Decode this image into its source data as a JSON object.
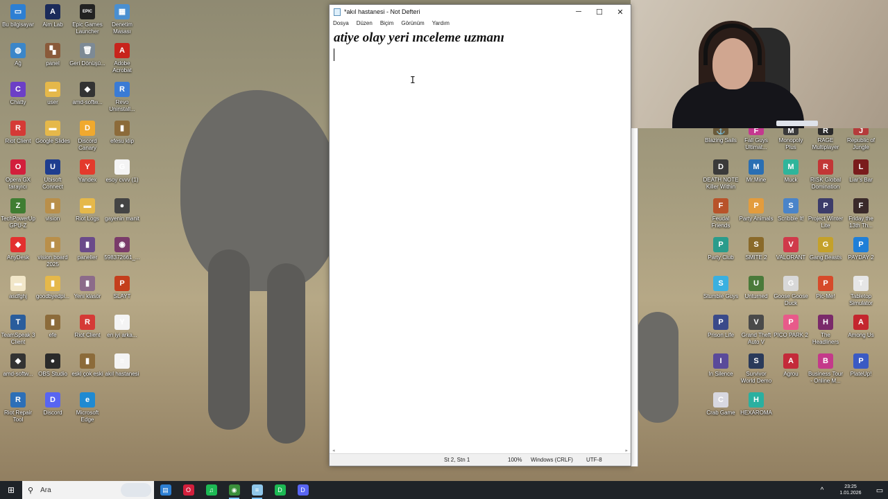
{
  "desktop": {
    "icons_left": [
      {
        "label": "Bu bilgisayar",
        "glyph": "▭",
        "color": "#2d7fd3"
      },
      {
        "label": "Aim Lab",
        "glyph": "A",
        "color": "#1b2b5a"
      },
      {
        "label": "Epic Games Launcher",
        "glyph": "EPIC",
        "color": "#222222"
      },
      {
        "label": "Denetim Masası",
        "glyph": "▦",
        "color": "#4a8fd0"
      },
      {
        "label": "Ağ",
        "glyph": "◍",
        "color": "#3b86c9"
      },
      {
        "label": "panel",
        "glyph": "▚",
        "color": "#8a5a3a"
      },
      {
        "label": "Geri Dönüşü...",
        "glyph": "🗑",
        "color": "#7d8a95"
      },
      {
        "label": "Adobe Acrobat",
        "glyph": "A",
        "color": "#c8241c"
      },
      {
        "label": "Chatty",
        "glyph": "C",
        "color": "#6c3fc7"
      },
      {
        "label": "user",
        "glyph": "▬",
        "color": "#e5b84a"
      },
      {
        "label": "amd-softw...",
        "glyph": "◆",
        "color": "#333333"
      },
      {
        "label": "Revo Uninstall...",
        "glyph": "R",
        "color": "#3a7bd5"
      },
      {
        "label": "Riot Client",
        "glyph": "R",
        "color": "#d53a36"
      },
      {
        "label": "Google Slides",
        "glyph": "▬",
        "color": "#e5b84a"
      },
      {
        "label": "Discord Canary",
        "glyph": "D",
        "color": "#f0a92e"
      },
      {
        "label": "efesu klip",
        "glyph": "▮",
        "color": "#8c6b3a"
      },
      {
        "label": "Opera GX tarayıcı",
        "glyph": "O",
        "color": "#d21f3c"
      },
      {
        "label": "Ubisoft Connect",
        "glyph": "U",
        "color": "#1e3d8f"
      },
      {
        "label": "Yandex",
        "glyph": "Y",
        "color": "#e33a2c"
      },
      {
        "label": "esoy cvvv (1)",
        "glyph": "G",
        "color": "#f4f4f4"
      },
      {
        "label": "TechPowerUp GPU-Z",
        "glyph": "Z",
        "color": "#3f7d32"
      },
      {
        "label": "vision",
        "glyph": "▮",
        "color": "#b98f4a"
      },
      {
        "label": "Riot Logs",
        "glyph": "▬",
        "color": "#e5b84a"
      },
      {
        "label": "gayenin manit",
        "glyph": "●",
        "color": "#444444"
      },
      {
        "label": "AnyDesk",
        "glyph": "◆",
        "color": "#e3302f"
      },
      {
        "label": "vision board 2025",
        "glyph": "▮",
        "color": "#b98f4a"
      },
      {
        "label": "paneller",
        "glyph": "▮",
        "color": "#6a4a8a"
      },
      {
        "label": "598372661_...",
        "glyph": "◉",
        "color": "#7a3b6a"
      },
      {
        "label": "asdfghj",
        "glyph": "▬",
        "color": "#f2e7c9"
      },
      {
        "label": "goodbyedpi...",
        "glyph": "▮",
        "color": "#e5b84a"
      },
      {
        "label": "Yeni klasör",
        "glyph": "▮",
        "color": "#8c6b8a"
      },
      {
        "label": "SLAYT",
        "glyph": "P",
        "color": "#c43e1c"
      },
      {
        "label": "TeamSpeak 3 Client",
        "glyph": "T",
        "color": "#2a5d9c"
      },
      {
        "label": "efe",
        "glyph": "▮",
        "color": "#8c6b3a"
      },
      {
        "label": "Riot Client",
        "glyph": "R",
        "color": "#d53a36"
      },
      {
        "label": "en iyi arka...",
        "glyph": "Y",
        "color": "#f4f4f4"
      },
      {
        "label": "amd-softw...",
        "glyph": "◆",
        "color": "#333333"
      },
      {
        "label": "OBS Studio",
        "glyph": "●",
        "color": "#2a2a2a"
      },
      {
        "label": "eski çok eski",
        "glyph": "▮",
        "color": "#8c6b3a"
      },
      {
        "label": "akıl hastanesi",
        "glyph": "≡",
        "color": "#f4f4f4"
      },
      {
        "label": "Riot Repair Tool",
        "glyph": "R",
        "color": "#2d6fb7"
      },
      {
        "label": "Discord",
        "glyph": "D",
        "color": "#5865f2"
      },
      {
        "label": "Microsoft Edge",
        "glyph": "e",
        "color": "#1f8ad2"
      }
    ],
    "icons_right": [
      {
        "label": "Blazing Sails",
        "glyph": "⚓",
        "color": "#6a5a3a"
      },
      {
        "label": "Fall Guys Ultimat...",
        "glyph": "F",
        "color": "#c4388f"
      },
      {
        "label": "Monopoly Plus",
        "glyph": "M",
        "color": "#3a3a3a"
      },
      {
        "label": "RAGE Multiplayer",
        "glyph": "R",
        "color": "#2b2b2b"
      },
      {
        "label": "Republic of Jungle",
        "glyph": "J",
        "color": "#b53b3b"
      },
      {
        "label": "DEATH NOTE Killer Within",
        "glyph": "D",
        "color": "#3a3a3a"
      },
      {
        "label": "Mr.Mine",
        "glyph": "M",
        "color": "#2a6fb3"
      },
      {
        "label": "Muck",
        "glyph": "M",
        "color": "#2fb59b"
      },
      {
        "label": "RISK Global Domination",
        "glyph": "R",
        "color": "#c23636"
      },
      {
        "label": "Liar's Bar",
        "glyph": "L",
        "color": "#7a1c1c"
      },
      {
        "label": "Feudal Friends",
        "glyph": "F",
        "color": "#b8532a"
      },
      {
        "label": "Party Animals",
        "glyph": "P",
        "color": "#e39c3d"
      },
      {
        "label": "Scribble It!",
        "glyph": "S",
        "color": "#4a84c9"
      },
      {
        "label": "Project Winter Lite",
        "glyph": "P",
        "color": "#3c3c6a"
      },
      {
        "label": "Friday the 13th Th...",
        "glyph": "F",
        "color": "#3a2a2a"
      },
      {
        "label": "Party Club",
        "glyph": "P",
        "color": "#2a9c8c"
      },
      {
        "label": "SMITE 2",
        "glyph": "S",
        "color": "#8a6a2a"
      },
      {
        "label": "VALORANT",
        "glyph": "V",
        "color": "#d03a4a"
      },
      {
        "label": "Gang Beasts",
        "glyph": "G",
        "color": "#c4a12a"
      },
      {
        "label": "PAYDAY 2",
        "glyph": "P",
        "color": "#1f7fd8"
      },
      {
        "label": "Stumble Guys",
        "glyph": "S",
        "color": "#3ab0e0"
      },
      {
        "label": "Unturned",
        "glyph": "U",
        "color": "#4a7a3a"
      },
      {
        "label": "Goose Goose Duck",
        "glyph": "G",
        "color": "#d8d8d8"
      },
      {
        "label": "Pic-Me!",
        "glyph": "P",
        "color": "#d64a2a"
      },
      {
        "label": "Tabletop Simulator",
        "glyph": "T",
        "color": "#e6e6e6"
      },
      {
        "label": "Prison Life",
        "glyph": "P",
        "color": "#3a4a8a"
      },
      {
        "label": "Grand Theft Auto V",
        "glyph": "V",
        "color": "#4a4a4a"
      },
      {
        "label": "PICO PARK 2",
        "glyph": "P",
        "color": "#e85a8a"
      },
      {
        "label": "The Headliners",
        "glyph": "H",
        "color": "#7a2a6a"
      },
      {
        "label": "Among Us",
        "glyph": "A",
        "color": "#c4262e"
      },
      {
        "label": "In Silence",
        "glyph": "I",
        "color": "#5a4a9a"
      },
      {
        "label": "Survivor World Demo",
        "glyph": "S",
        "color": "#2a3a5a"
      },
      {
        "label": "Agrou",
        "glyph": "A",
        "color": "#c42a3a"
      },
      {
        "label": "Business Tour - Online M...",
        "glyph": "B",
        "color": "#c43a8a"
      },
      {
        "label": "PlateUp!",
        "glyph": "P",
        "color": "#3a5ac4"
      },
      {
        "label": "Crab Game",
        "glyph": "C",
        "color": "#d8d8e0"
      },
      {
        "label": "HEXAROMA",
        "glyph": "H",
        "color": "#2ab0a0"
      }
    ]
  },
  "notepad": {
    "title": "*akıl hastanesi - Not Defteri",
    "menu": [
      "Dosya",
      "Düzen",
      "Biçim",
      "Görünüm",
      "Yardım"
    ],
    "content_line": "atiye olay yeri ınceleme uzmanı",
    "status": {
      "position": "St 2, Stn 1",
      "zoom": "100%",
      "line_ending": "Windows (CRLF)",
      "encoding": "UTF-8"
    },
    "controls": {
      "minimize": "─",
      "maximize": "☐",
      "close": "✕"
    }
  },
  "taskbar": {
    "start_glyph": "⊞",
    "search_placeholder": "Ara",
    "search_glyph": "⚲",
    "apps": [
      {
        "name": "file-explorer",
        "glyph": "▤",
        "color": "#2d7fd3",
        "active": false
      },
      {
        "name": "opera-gx",
        "glyph": "O",
        "color": "#d21f3c",
        "active": false
      },
      {
        "name": "spotify",
        "glyph": "♫",
        "color": "#1db954",
        "active": false
      },
      {
        "name": "chrome",
        "glyph": "◉",
        "color": "#3a8f3a",
        "active": true
      },
      {
        "name": "notepad",
        "glyph": "≡",
        "color": "#8fc7ea",
        "active": true
      },
      {
        "name": "discord-green",
        "glyph": "D",
        "color": "#1db954",
        "active": false
      },
      {
        "name": "discord",
        "glyph": "D",
        "color": "#5865f2",
        "active": false
      }
    ],
    "tray_chevron": "^",
    "time": "23:25",
    "date": "1.01.2026",
    "notif_glyph": "▭"
  }
}
